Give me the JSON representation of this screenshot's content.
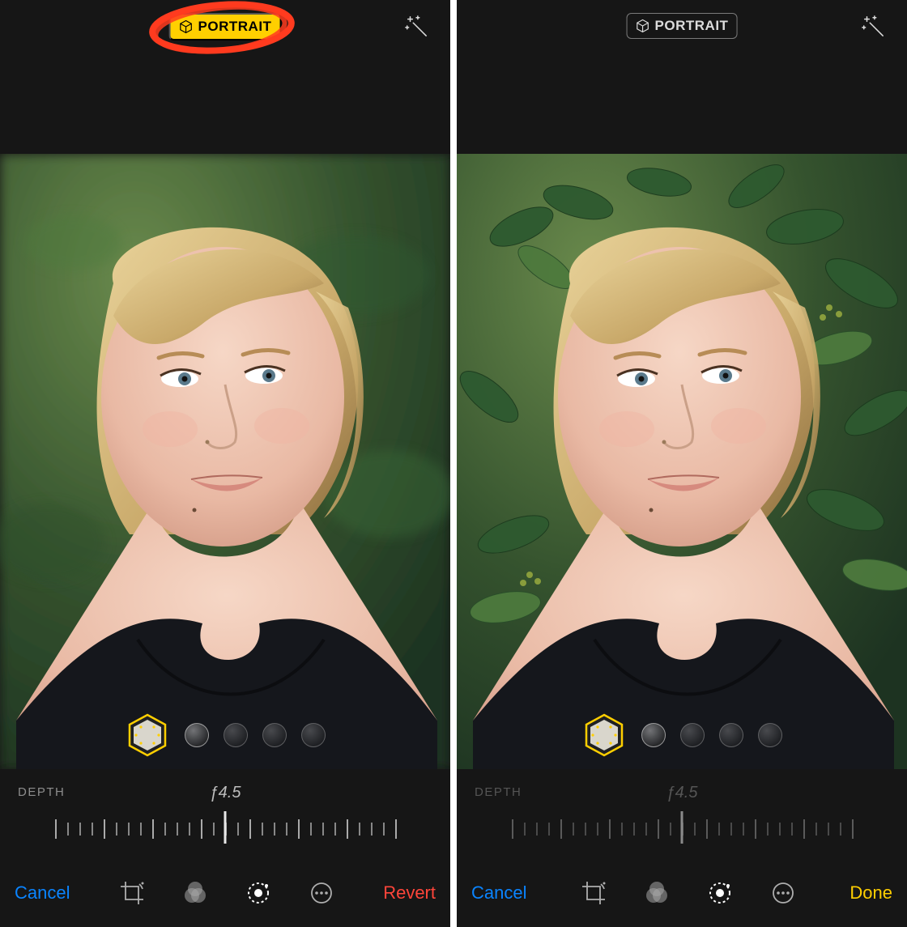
{
  "left": {
    "portrait_label": "PORTRAIT",
    "portrait_active": true,
    "annotated": true,
    "depth_label": "DEPTH",
    "depth_value": "ƒ4.5",
    "depth_enabled": true,
    "lighting_options_count": 4,
    "toolbar": {
      "cancel": "Cancel",
      "action_label": "Revert",
      "action_kind": "revert"
    }
  },
  "right": {
    "portrait_label": "PORTRAIT",
    "portrait_active": false,
    "annotated": false,
    "depth_label": "DEPTH",
    "depth_value": "ƒ4.5",
    "depth_enabled": false,
    "lighting_options_count": 4,
    "toolbar": {
      "cancel": "Cancel",
      "action_label": "Done",
      "action_kind": "done"
    }
  },
  "colors": {
    "accent_yellow": "#ffcf00",
    "accent_blue": "#0a84ff",
    "accent_red": "#ff453a",
    "bg": "#161616"
  }
}
